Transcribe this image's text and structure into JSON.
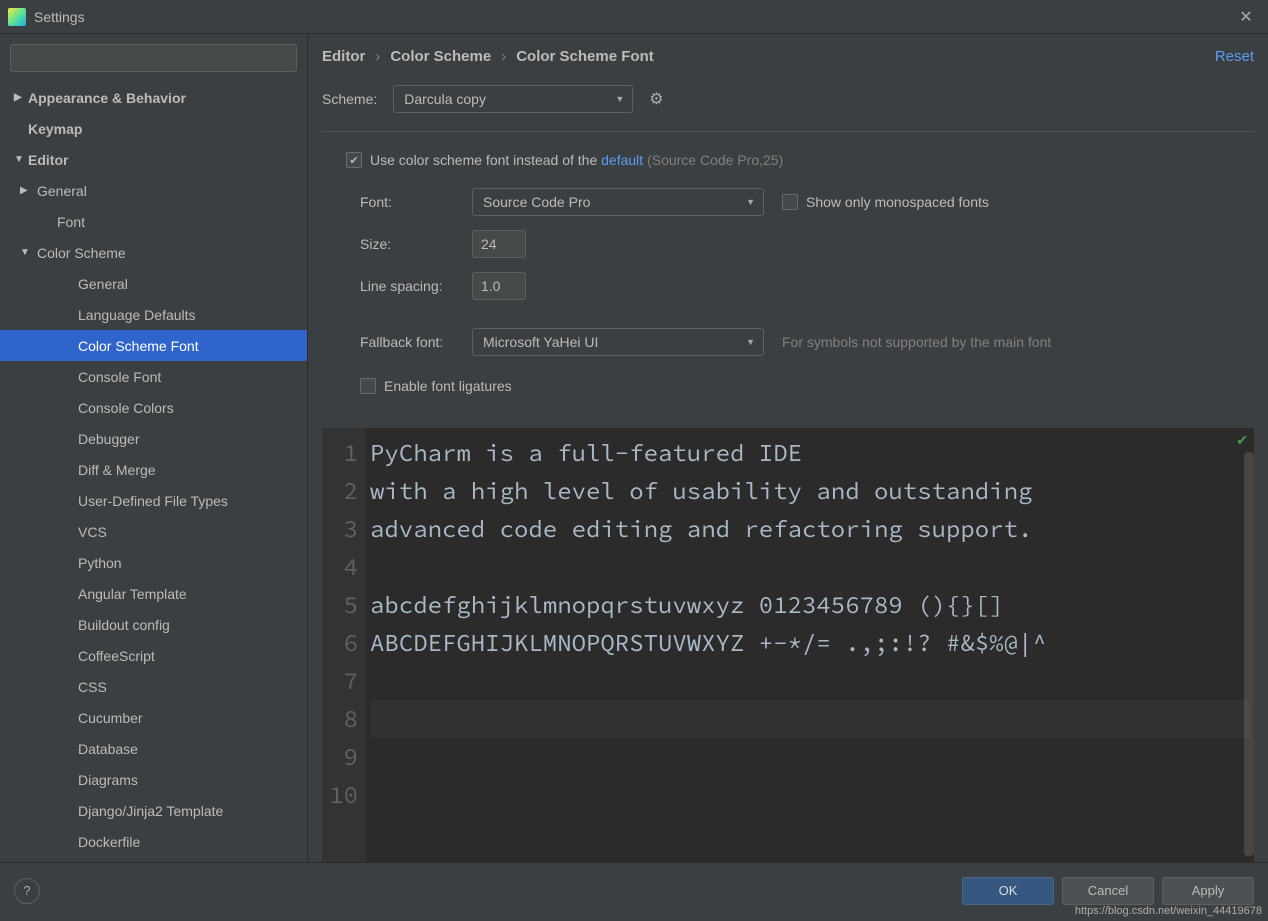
{
  "window": {
    "title": "Settings"
  },
  "sidebar": {
    "search_placeholder": "",
    "items": [
      {
        "label": "Appearance & Behavior",
        "arrow": "▶",
        "bold": true,
        "level": 0
      },
      {
        "label": "Keymap",
        "arrow": "",
        "bold": true,
        "level": 0
      },
      {
        "label": "Editor",
        "arrow": "▼",
        "bold": true,
        "level": 0
      },
      {
        "label": "General",
        "arrow": "▶",
        "bold": false,
        "level": 1
      },
      {
        "label": "Font",
        "arrow": "",
        "bold": false,
        "level": 2
      },
      {
        "label": "Color Scheme",
        "arrow": "▼",
        "bold": false,
        "level": 1
      },
      {
        "label": "General",
        "arrow": "",
        "bold": false,
        "level": 3
      },
      {
        "label": "Language Defaults",
        "arrow": "",
        "bold": false,
        "level": 3
      },
      {
        "label": "Color Scheme Font",
        "arrow": "",
        "bold": false,
        "level": 3,
        "selected": true
      },
      {
        "label": "Console Font",
        "arrow": "",
        "bold": false,
        "level": 3
      },
      {
        "label": "Console Colors",
        "arrow": "",
        "bold": false,
        "level": 3
      },
      {
        "label": "Debugger",
        "arrow": "",
        "bold": false,
        "level": 3
      },
      {
        "label": "Diff & Merge",
        "arrow": "",
        "bold": false,
        "level": 3
      },
      {
        "label": "User-Defined File Types",
        "arrow": "",
        "bold": false,
        "level": 3
      },
      {
        "label": "VCS",
        "arrow": "",
        "bold": false,
        "level": 3
      },
      {
        "label": "Python",
        "arrow": "",
        "bold": false,
        "level": 3
      },
      {
        "label": "Angular Template",
        "arrow": "",
        "bold": false,
        "level": 3
      },
      {
        "label": "Buildout config",
        "arrow": "",
        "bold": false,
        "level": 3
      },
      {
        "label": "CoffeeScript",
        "arrow": "",
        "bold": false,
        "level": 3
      },
      {
        "label": "CSS",
        "arrow": "",
        "bold": false,
        "level": 3
      },
      {
        "label": "Cucumber",
        "arrow": "",
        "bold": false,
        "level": 3
      },
      {
        "label": "Database",
        "arrow": "",
        "bold": false,
        "level": 3
      },
      {
        "label": "Diagrams",
        "arrow": "",
        "bold": false,
        "level": 3
      },
      {
        "label": "Django/Jinja2 Template",
        "arrow": "",
        "bold": false,
        "level": 3
      },
      {
        "label": "Dockerfile",
        "arrow": "",
        "bold": false,
        "level": 3
      }
    ]
  },
  "breadcrumb": {
    "parts": [
      "Editor",
      "Color Scheme",
      "Color Scheme Font"
    ],
    "reset": "Reset"
  },
  "scheme": {
    "label": "Scheme:",
    "value": "Darcula copy"
  },
  "form": {
    "use_scheme_font_label_pre": "Use color scheme font instead of the ",
    "default_link": "default",
    "default_hint": "(Source Code Pro,25)",
    "font_label": "Font:",
    "font_value": "Source Code Pro",
    "mono_label": "Show only monospaced fonts",
    "size_label": "Size:",
    "size_value": "24",
    "spacing_label": "Line spacing:",
    "spacing_value": "1.0",
    "fallback_label": "Fallback font:",
    "fallback_value": "Microsoft YaHei UI",
    "fallback_hint": "For symbols not supported by the main font",
    "ligatures_label": "Enable font ligatures"
  },
  "preview": {
    "gutter": [
      "1",
      "2",
      "3",
      "4",
      "5",
      "6",
      "7",
      "8",
      "9",
      "10"
    ],
    "lines": [
      "PyCharm is a full-featured IDE",
      "with a high level of usability and outstanding",
      "advanced code editing and refactoring support.",
      "",
      "abcdefghijklmnopqrstuvwxyz 0123456789 (){}[]",
      "ABCDEFGHIJKLMNOPQRSTUVWXYZ +-*/= .,;:!? #&$%@|^",
      "",
      "",
      "",
      ""
    ],
    "highlight_index": 7
  },
  "footer": {
    "ok": "OK",
    "cancel": "Cancel",
    "apply": "Apply"
  },
  "watermark": "https://blog.csdn.net/weixin_44419678"
}
